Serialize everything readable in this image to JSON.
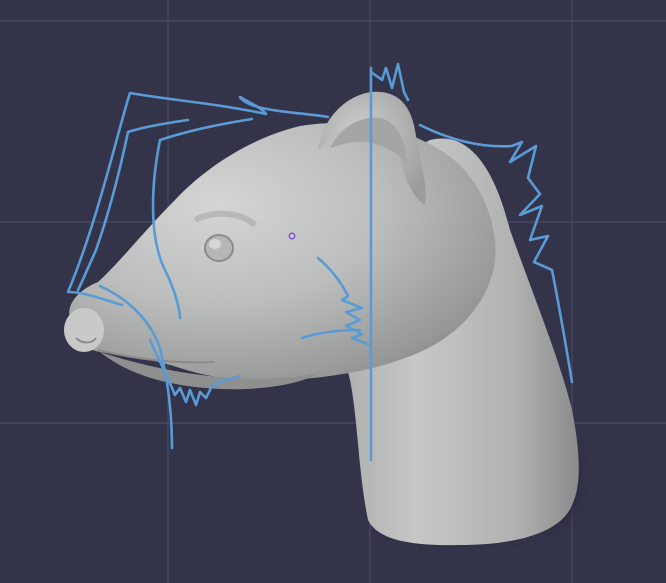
{
  "viewport": {
    "background_color": "#33334a",
    "grid_color": "#4a4a62",
    "subject": "ferret-head-sculpt"
  },
  "model": {
    "base_color": "#b8baba",
    "highlight_color": "#d2d4d4",
    "shadow_color": "#6e7070"
  },
  "annotation": {
    "stroke_color": "#5b9bd5",
    "tool": "annotate-pencil"
  },
  "cursor": {
    "color": "#7b4ad6",
    "icon": "brush-cursor-icon"
  }
}
